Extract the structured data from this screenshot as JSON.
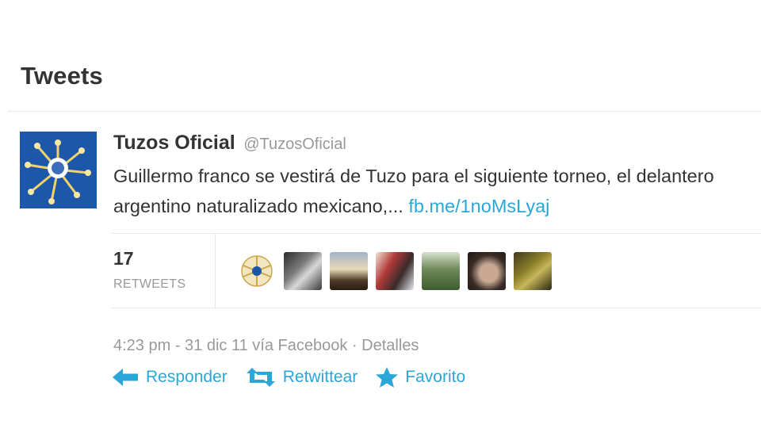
{
  "timeline": {
    "heading": "Tweets"
  },
  "tweet": {
    "author_name": "Tuzos Oficial",
    "author_handle": "@TuzosOficial",
    "text": "Guillermo franco se vestirá de Tuzo para el siguiente torneo, el delantero argentino naturalizado mexicano,... ",
    "link_text": "fb.me/1noMsLyaj",
    "retweets": {
      "count": "17",
      "label": "RETWEETS"
    },
    "retweeter_avatars": [
      "avatar-1",
      "avatar-2",
      "avatar-3",
      "avatar-4",
      "avatar-5",
      "avatar-6",
      "avatar-7"
    ],
    "meta": {
      "time": "4:23 pm - 31 dic 11",
      "via": "vía Facebook",
      "separator": "·",
      "details": "Detalles"
    },
    "actions": {
      "reply": "Responder",
      "retweet": "Retwittear",
      "favorite": "Favorito"
    }
  },
  "colors": {
    "link": "#2aa7d8",
    "text": "#333333",
    "muted": "#999999"
  },
  "icons": {
    "reply": "reply-arrow-icon",
    "retweet": "retweet-icon",
    "favorite": "star-icon"
  }
}
